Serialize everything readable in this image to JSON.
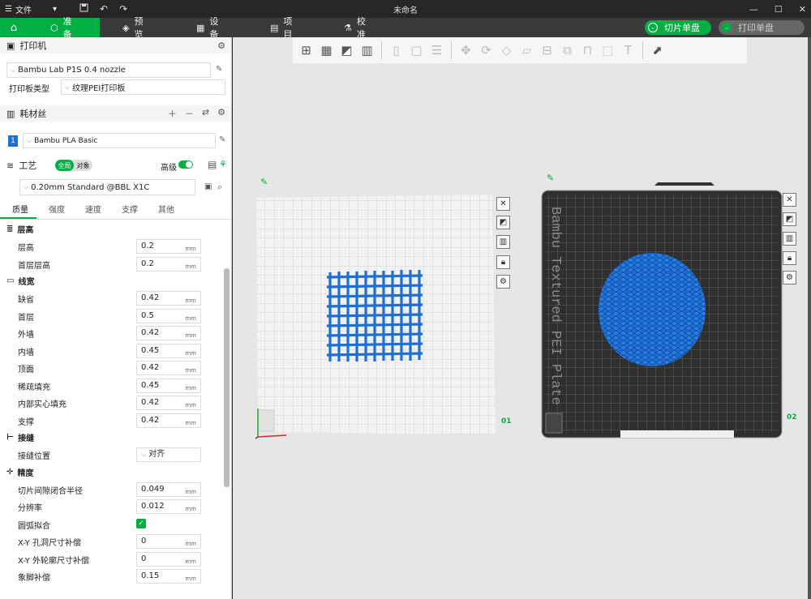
{
  "titlebar": {
    "menu_label": "文件",
    "window_title": "未命名",
    "caret": "▾"
  },
  "nav": {
    "tabs": [
      {
        "label": "准备"
      },
      {
        "label": "预览"
      },
      {
        "label": "设备"
      },
      {
        "label": "项目"
      },
      {
        "label": "校准"
      }
    ],
    "slice_label": "切片单盘",
    "print_label": "打印单盘"
  },
  "printer": {
    "section_title": "打印机",
    "printer_name": "Bambu Lab P1S 0.4 nozzle",
    "plate_type_label": "打印板类型",
    "plate_type_value": "纹理PEI打印板"
  },
  "filament": {
    "section_title": "耗材丝",
    "slot": "1",
    "name": "Bambu PLA Basic"
  },
  "process": {
    "section_title": "工艺",
    "toggle_global": "全局",
    "toggle_object": "对象",
    "advanced_label": "高级",
    "preset": "0.20mm Standard @BBL X1C"
  },
  "subtabs": [
    {
      "label": "质量",
      "active": true
    },
    {
      "label": "强度"
    },
    {
      "label": "速度"
    },
    {
      "label": "支撑"
    },
    {
      "label": "其他"
    }
  ],
  "unit": "mm",
  "groups": [
    {
      "title": "层高",
      "rows": [
        {
          "label": "层高",
          "value": "0.2",
          "unit": "mm"
        },
        {
          "label": "首层层高",
          "value": "0.2",
          "unit": "mm"
        }
      ]
    },
    {
      "title": "线宽",
      "rows": [
        {
          "label": "缺省",
          "value": "0.42",
          "unit": "mm"
        },
        {
          "label": "首层",
          "value": "0.5",
          "unit": "mm"
        },
        {
          "label": "外墙",
          "value": "0.42",
          "unit": "mm"
        },
        {
          "label": "内墙",
          "value": "0.45",
          "unit": "mm"
        },
        {
          "label": "顶面",
          "value": "0.42",
          "unit": "mm"
        },
        {
          "label": "稀疏填充",
          "value": "0.45",
          "unit": "mm"
        },
        {
          "label": "内部实心填充",
          "value": "0.42",
          "unit": "mm"
        },
        {
          "label": "支撑",
          "value": "0.42",
          "unit": "mm"
        }
      ]
    },
    {
      "title": "接缝",
      "rows": [
        {
          "label": "接缝位置",
          "value": "对齐",
          "unit": "",
          "dropdown": true
        }
      ]
    },
    {
      "title": "精度",
      "rows": [
        {
          "label": "切片间隙闭合半径",
          "value": "0.049",
          "unit": "mm"
        },
        {
          "label": "分辨率",
          "value": "0.012",
          "unit": "mm"
        },
        {
          "label": "圆弧拟合",
          "value": "",
          "unit": "",
          "checkbox": true
        },
        {
          "label": "X-Y 孔洞尺寸补偿",
          "value": "0",
          "unit": "mm"
        },
        {
          "label": "X-Y 外轮廓尺寸补偿",
          "value": "0",
          "unit": "mm"
        },
        {
          "label": "象脚补偿",
          "value": "0.15",
          "unit": "mm"
        }
      ]
    }
  ],
  "plates": [
    {
      "number": "01"
    },
    {
      "number": "02",
      "bed_label": "Bambu Textured PEI Plate"
    }
  ],
  "colors": {
    "accent": "#00ae42",
    "model": "#1e6fd0"
  }
}
